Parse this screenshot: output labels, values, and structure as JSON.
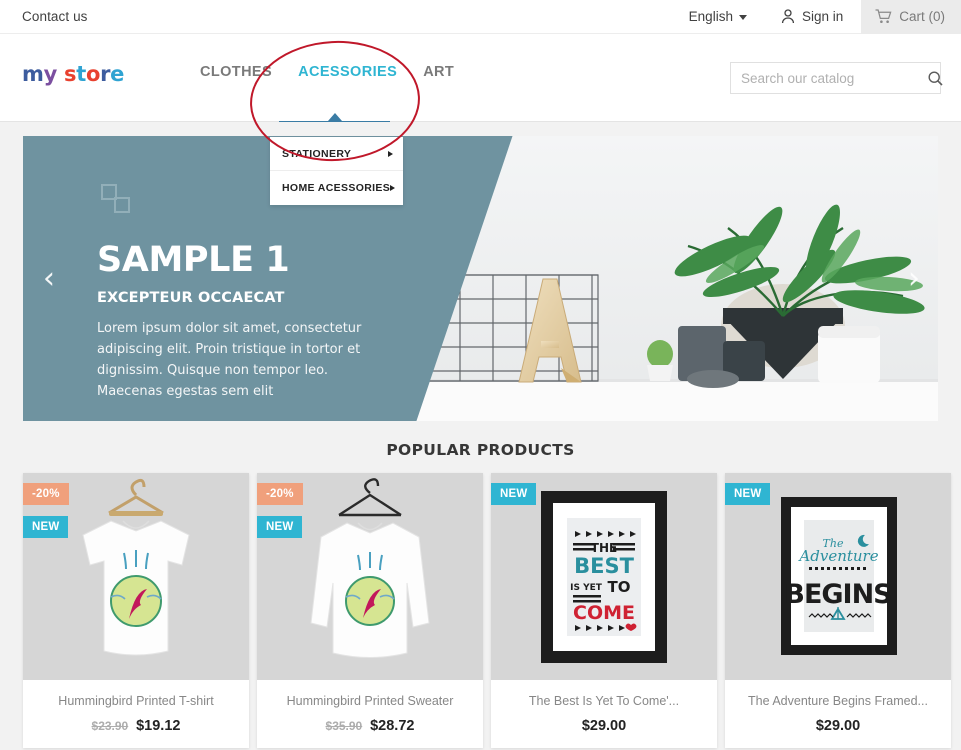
{
  "topbar": {
    "contact": "Contact us",
    "language": "English",
    "signin": "Sign in",
    "cart": "Cart (0)",
    "icons": {
      "lang_caret": "chevron-down-icon",
      "user": "user-icon",
      "cart": "shopping-cart-icon"
    }
  },
  "header": {
    "logo": {
      "part1": "my",
      "part2": "store"
    },
    "nav": [
      {
        "label": "CLOTHES",
        "active": false
      },
      {
        "label": "ACESSORIES",
        "active": true
      },
      {
        "label": "ART",
        "active": false
      }
    ],
    "dropdown": [
      {
        "label": "STATIONERY"
      },
      {
        "label": "HOME ACESSORIES"
      }
    ],
    "search": {
      "placeholder": "Search our catalog",
      "value": "",
      "icon": "search-icon"
    }
  },
  "hero": {
    "title": "SAMPLE 1",
    "subtitle": "EXCEPTEUR OCCAECAT",
    "body": "Lorem ipsum dolor sit amet, consectetur adipiscing elit. Proin tristique in tortor et dignissim. Quisque non tempor leo. Maecenas egestas sem elit",
    "prev": "‹",
    "next": "›",
    "overlay_color": "#6f93a0"
  },
  "popular": {
    "heading": "POPULAR PRODUCTS",
    "products": [
      {
        "name": "Hummingbird Printed T-shirt",
        "price_old": "$23.90",
        "price_new": "$19.12",
        "badges": [
          {
            "text": "-20%",
            "type": "discount",
            "color": "#f0a07c"
          },
          {
            "text": "NEW",
            "type": "new",
            "color": "#2fb5d2"
          }
        ]
      },
      {
        "name": "Hummingbird Printed Sweater",
        "price_old": "$35.90",
        "price_new": "$28.72",
        "badges": [
          {
            "text": "-20%",
            "type": "discount",
            "color": "#f0a07c"
          },
          {
            "text": "NEW",
            "type": "new",
            "color": "#2fb5d2"
          }
        ]
      },
      {
        "name": "The Best Is Yet To Come'...",
        "price_old": "",
        "price_new": "$29.00",
        "badges": [
          {
            "text": "NEW",
            "type": "new",
            "color": "#2fb5d2"
          }
        ]
      },
      {
        "name": "The Adventure Begins Framed...",
        "price_old": "",
        "price_new": "$29.00",
        "badges": [
          {
            "text": "NEW",
            "type": "new",
            "color": "#2fb5d2"
          }
        ]
      }
    ]
  },
  "annotation": {
    "shape": "red-ellipse",
    "color": "#c0182a"
  }
}
